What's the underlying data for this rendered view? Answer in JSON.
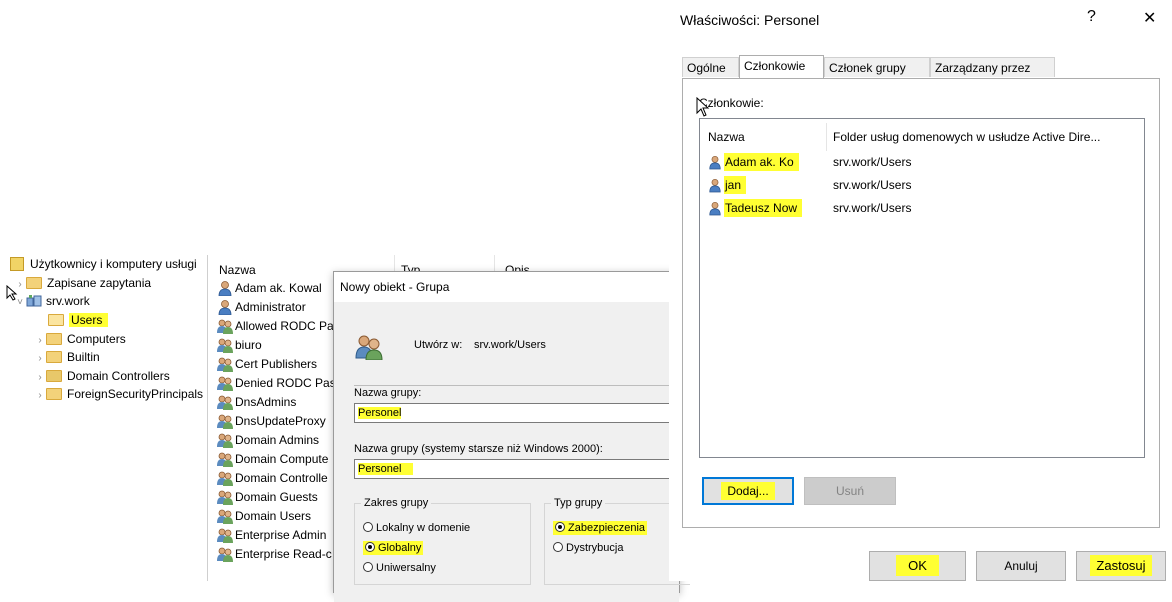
{
  "tree": {
    "root_label": "Użytkownicy i komputery usługi",
    "items": [
      {
        "label": "Zapisane zapytania",
        "expanded": false
      },
      {
        "label": "srv.work",
        "expanded": true
      },
      {
        "label": "Users",
        "selected": true
      },
      {
        "label": "Computers"
      },
      {
        "label": "Builtin"
      },
      {
        "label": "Domain Controllers"
      },
      {
        "label": "ForeignSecurityPrincipals"
      }
    ]
  },
  "list": {
    "columns": [
      "Nazwa",
      "Typ",
      "Opis"
    ],
    "rows": [
      "Adam ak. Kowal",
      "Administrator",
      "Allowed RODC Pa",
      "biuro",
      "Cert Publishers",
      "Denied RODC Pas",
      "DnsAdmins",
      "DnsUpdateProxy",
      "Domain Admins",
      "Domain Compute",
      "Domain Controlle",
      "Domain Guests",
      "Domain Users",
      "Enterprise Admin",
      "Enterprise Read-c"
    ]
  },
  "new_object": {
    "title": "Nowy obiekt - Grupa",
    "create_in_label": "Utwórz w:",
    "create_in_value": "srv.work/Users",
    "group_name_label": "Nazwa grupy:",
    "group_name_value": "Personel",
    "legacy_name_label": "Nazwa grupy (systemy starsze niż Windows 2000):",
    "legacy_name_value": "Personel",
    "scope_label": "Zakres grupy",
    "scope_options": [
      "Lokalny w domenie",
      "Globalny",
      "Uniwersalny"
    ],
    "type_label": "Typ grupy",
    "type_options": [
      "Zabezpieczenia",
      "Dystrybucja"
    ]
  },
  "properties": {
    "title": "Właściwości: Personel",
    "help_glyph": "?",
    "close_glyph": "✕",
    "tabs": [
      "Ogólne",
      "Członkowie",
      "Członek grupy",
      "Zarządzany przez"
    ],
    "members_label": "Członkowie:",
    "columns": [
      "Nazwa",
      "Folder usług domenowych w usłudze Active Dire..."
    ],
    "members": [
      {
        "name": "Adam ak. Ko",
        "folder": "srv.work/Users"
      },
      {
        "name": "jan",
        "folder": "srv.work/Users"
      },
      {
        "name": "Tadeusz Now",
        "folder": "srv.work/Users"
      }
    ],
    "add_button": "Dodaj...",
    "remove_button": "Usuń",
    "ok_button": "OK",
    "cancel_button": "Anuluj",
    "apply_button": "Zastosuj"
  },
  "colors": {
    "highlight": "#ffff33",
    "accent": "#0078d7"
  }
}
